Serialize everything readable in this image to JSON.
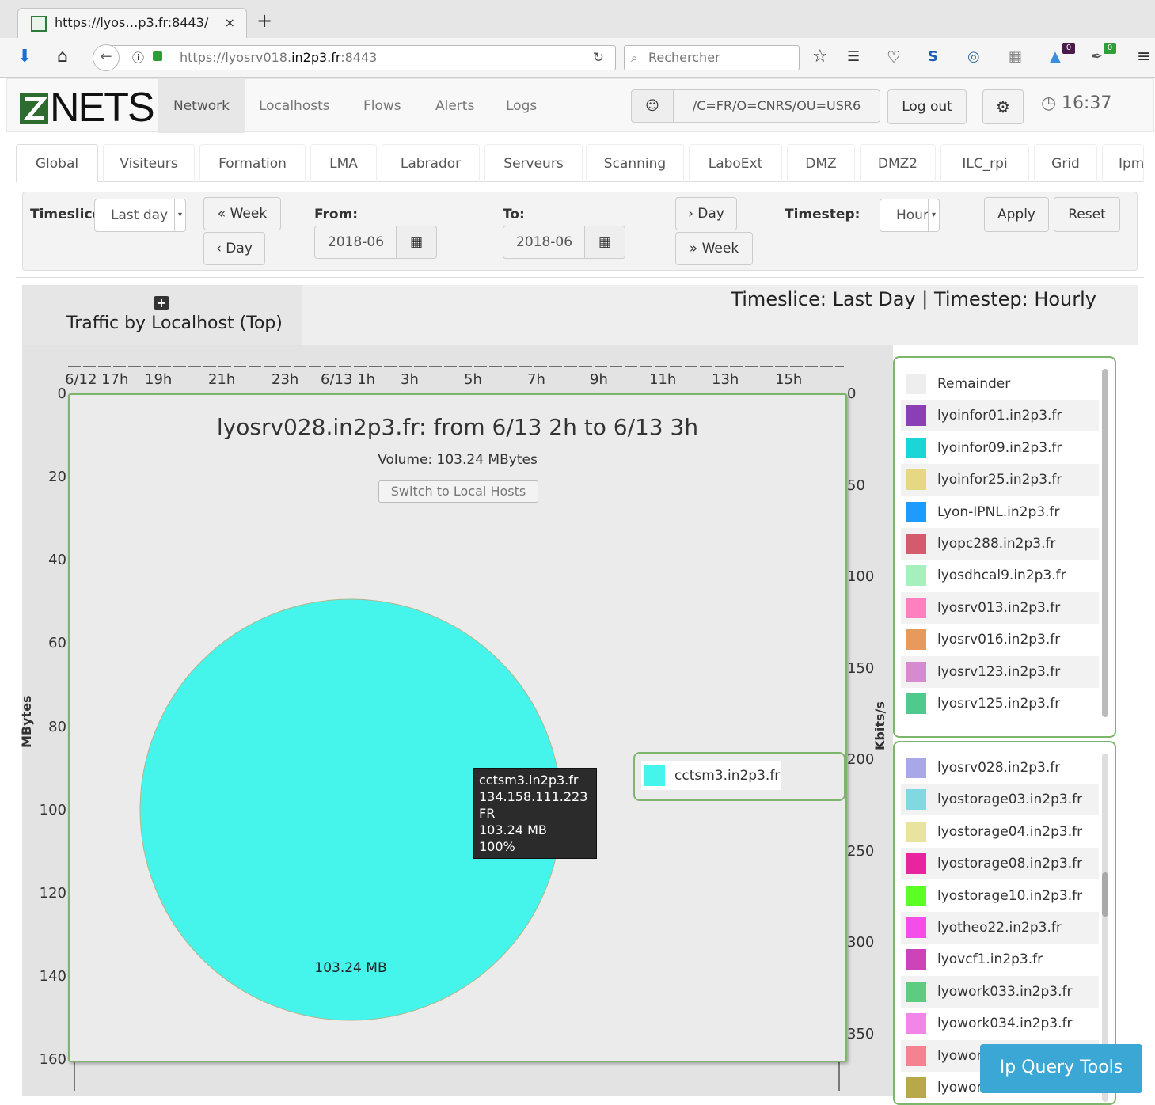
{
  "browser": {
    "tab_title": "https://lyos…p3.fr:8443/",
    "tab_close": "×",
    "new_tab": "+",
    "url_prefix": "https://lyosrv018.",
    "url_domain": "in2p3.fr",
    "url_suffix": ":8443",
    "search_placeholder": "Rechercher",
    "badge_count_1": "0",
    "badge_count_2": "0"
  },
  "app": {
    "brand": "NETS",
    "nav": [
      "Network",
      "Localhosts",
      "Flows",
      "Alerts",
      "Logs"
    ],
    "user_dn": "/C=FR/O=CNRS/OU=USR6",
    "logout": "Log out",
    "clock": "16:37"
  },
  "subtabs": [
    "Global",
    "Visiteurs",
    "Formation",
    "LMA",
    "Labrador",
    "Serveurs",
    "Scanning",
    "LaboExt",
    "DMZ",
    "DMZ2",
    "ILC_rpi",
    "Grid",
    "Ipm"
  ],
  "controls": {
    "timeslice_label": "Timeslice:",
    "timeslice_value": "Last day",
    "prev_week": "« Week",
    "prev_day": "‹ Day",
    "from_label": "From:",
    "from_value": "2018-06",
    "to_label": "To:",
    "to_value": "2018-06",
    "next_day": "› Day",
    "next_week": "» Week",
    "timestep_label": "Timestep:",
    "timestep_value": "Hourly",
    "apply": "Apply",
    "reset": "Reset"
  },
  "panel": {
    "title": "Traffic by Localhost (Top)",
    "subtitle": "Timeslice: Last Day | Timestep: Hourly"
  },
  "chart_data": {
    "type": "bar",
    "ylabel": "MBytes",
    "ylabel_right": "Kbits/s",
    "y_ticks_left": [
      "0",
      "20",
      "40",
      "60",
      "80",
      "100",
      "120",
      "140",
      "160"
    ],
    "y_ticks_right": [
      "0",
      "50",
      "100",
      "150",
      "200",
      "250",
      "300",
      "350"
    ],
    "x_ticks": [
      "6/12 17h",
      "19h",
      "21h",
      "23h",
      "6/13 1h",
      "3h",
      "5h",
      "7h",
      "9h",
      "11h",
      "13h",
      "15h"
    ],
    "ylim": [
      0,
      160
    ],
    "ylim_right": [
      0,
      350
    ]
  },
  "popup": {
    "title": "lyosrv028.in2p3.fr: from 6/13 2h to 6/13 3h",
    "volume": "Volume: 103.24 MBytes",
    "switch_button": "Switch to Local Hosts",
    "pie_chart": {
      "type": "pie",
      "slices": [
        {
          "label": "cctsm3.in2p3.fr",
          "value": 103.24,
          "unit": "MB",
          "percent": 100,
          "color": "#45f5ec"
        }
      ],
      "slice_label": "103.24 MB"
    },
    "tooltip": [
      "cctsm3.in2p3.fr",
      "134.158.111.223",
      "FR",
      "103.24 MB",
      "100%"
    ],
    "legend_item": "cctsm3.in2p3.fr"
  },
  "legend_top": [
    {
      "label": "Remainder",
      "color": "#eeeeee"
    },
    {
      "label": "lyoinfor01.in2p3.fr",
      "color": "#8b3fb5"
    },
    {
      "label": "lyoinfor09.in2p3.fr",
      "color": "#1ad6d6"
    },
    {
      "label": "lyoinfor25.in2p3.fr",
      "color": "#e6d882"
    },
    {
      "label": "Lyon-IPNL.in2p3.fr",
      "color": "#1e9bff"
    },
    {
      "label": "lyopc288.in2p3.fr",
      "color": "#d45a6e"
    },
    {
      "label": "lyosdhcal9.in2p3.fr",
      "color": "#a6f0bd"
    },
    {
      "label": "lyosrv013.in2p3.fr",
      "color": "#ff7fbf"
    },
    {
      "label": "lyosrv016.in2p3.fr",
      "color": "#e89a5c"
    },
    {
      "label": "lyosrv123.in2p3.fr",
      "color": "#d68ad0"
    },
    {
      "label": "lyosrv125.in2p3.fr",
      "color": "#4fc98c"
    }
  ],
  "legend_bottom": [
    {
      "label": "lyosrv028.in2p3.fr",
      "color": "#a9a7e8"
    },
    {
      "label": "lyostorage03.in2p3.fr",
      "color": "#80d8e0"
    },
    {
      "label": "lyostorage04.in2p3.fr",
      "color": "#e8e4a0"
    },
    {
      "label": "lyostorage08.in2p3.fr",
      "color": "#e8249e"
    },
    {
      "label": "lyostorage10.in2p3.fr",
      "color": "#5cff24"
    },
    {
      "label": "lyotheo22.in2p3.fr",
      "color": "#f54ee8"
    },
    {
      "label": "lyovcf1.in2p3.fr",
      "color": "#cc44b8"
    },
    {
      "label": "lyowork033.in2p3.fr",
      "color": "#5ecb80"
    },
    {
      "label": "lyowork034.in2p3.fr",
      "color": "#f285e8"
    },
    {
      "label": "lyowor",
      "color": "#f58290"
    },
    {
      "label": "lyowor",
      "color": "#b8a84a"
    }
  ],
  "ip_query_tools": "Ip Query Tools"
}
